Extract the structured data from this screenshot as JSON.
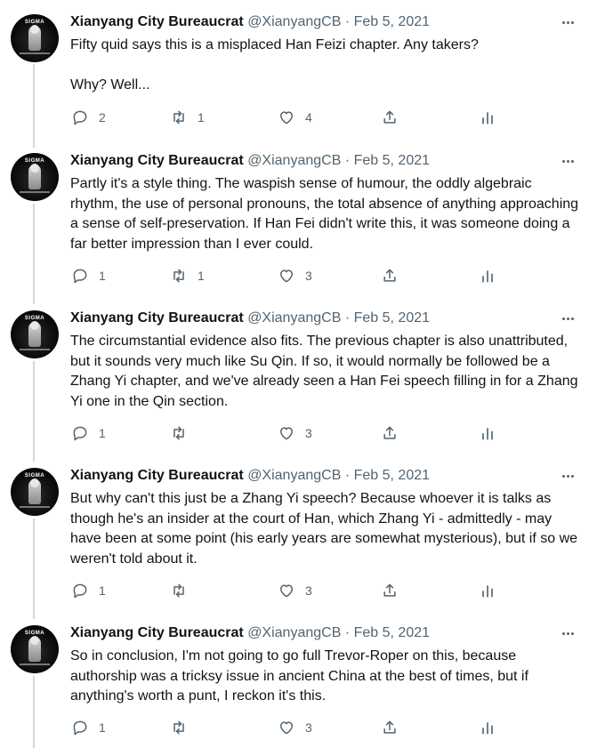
{
  "tweets": [
    {
      "name": "Xianyang City Bureaucrat",
      "handle": "@XianyangCB",
      "sep": "·",
      "date": "Feb 5, 2021",
      "text": "Fifty quid says this is a misplaced Han Feizi chapter. Any takers?\n\nWhy? Well...",
      "replies": "2",
      "retweets": "1",
      "likes": "4"
    },
    {
      "name": "Xianyang City Bureaucrat",
      "handle": "@XianyangCB",
      "sep": "·",
      "date": "Feb 5, 2021",
      "text": "Partly it's a style thing. The waspish sense of humour, the oddly algebraic rhythm, the use of personal pronouns, the total absence of anything approaching a sense of self-preservation. If Han Fei didn't write this, it was someone doing a far better impression than I ever could.",
      "replies": "1",
      "retweets": "1",
      "likes": "3"
    },
    {
      "name": "Xianyang City Bureaucrat",
      "handle": "@XianyangCB",
      "sep": "·",
      "date": "Feb 5, 2021",
      "text": "The circumstantial evidence also fits. The previous chapter is also unattributed, but it sounds very much like Su Qin. If so, it would normally be followed be a Zhang Yi chapter, and we've already seen a Han Fei speech filling in for a Zhang Yi one in the Qin section.",
      "replies": "1",
      "retweets": "",
      "likes": "3"
    },
    {
      "name": "Xianyang City Bureaucrat",
      "handle": "@XianyangCB",
      "sep": "·",
      "date": "Feb 5, 2021",
      "text": "But why can't this just be a Zhang Yi speech? Because whoever it is talks as though he's an insider at the court of Han, which Zhang Yi - admittedly - may have been at some point (his early years are somewhat mysterious), but if so we weren't told about it.",
      "replies": "1",
      "retweets": "",
      "likes": "3"
    },
    {
      "name": "Xianyang City Bureaucrat",
      "handle": "@XianyangCB",
      "sep": "·",
      "date": "Feb 5, 2021",
      "text": "So in conclusion, I'm not going to go full Trevor-Roper on this, because authorship was a tricksy issue in ancient China at the best of times, but if anything's worth a punt, I reckon it's this.",
      "replies": "1",
      "retweets": "",
      "likes": "3"
    }
  ],
  "avatar_text": "SIGMA",
  "icons": {
    "reply": "reply-icon",
    "retweet": "retweet-icon",
    "like": "heart-icon",
    "share": "share-icon",
    "analytics": "analytics-icon",
    "more": "more-icon"
  },
  "colors": {
    "text": "#0f1419",
    "secondary": "#536471",
    "thread_line": "#cfd9de",
    "background": "#ffffff"
  }
}
